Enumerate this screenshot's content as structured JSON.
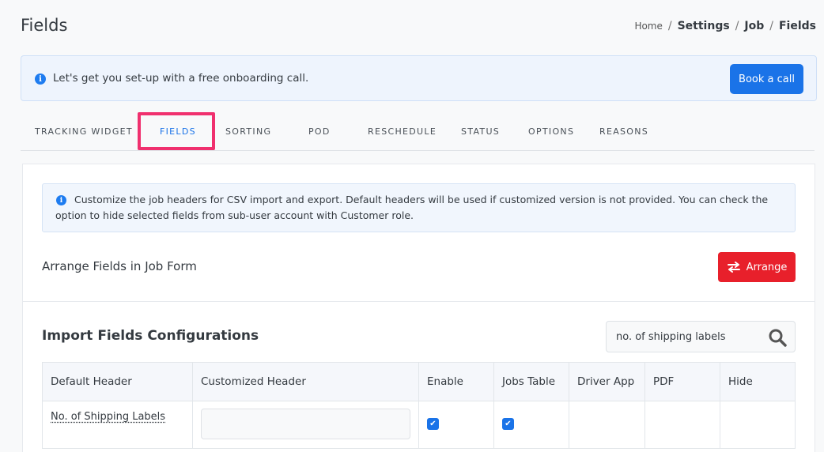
{
  "page": {
    "title": "Fields"
  },
  "breadcrumb": {
    "home": "Home",
    "sep": "/",
    "items": [
      "Settings",
      "Job",
      "Fields"
    ]
  },
  "onboarding": {
    "text": "Let's get you set-up with a free onboarding call.",
    "button": "Book a call"
  },
  "tabs": [
    {
      "label": "TRACKING WIDGET"
    },
    {
      "label": "FIELDS",
      "active": true
    },
    {
      "label": "SORTING"
    },
    {
      "label": "POD"
    },
    {
      "label": "RESCHEDULE"
    },
    {
      "label": "STATUS"
    },
    {
      "label": "OPTIONS"
    },
    {
      "label": "REASONS"
    }
  ],
  "alert": {
    "text": "Customize the job headers for CSV import and export. Default headers will be used if customized version is not provided. You can check the option to hide selected fields from sub-user account with Customer role."
  },
  "arrange": {
    "label": "Arrange Fields in Job Form",
    "button": "Arrange"
  },
  "import": {
    "title": "Import Fields Configurations",
    "search_value": "no. of shipping labels"
  },
  "table": {
    "headers": [
      "Default Header",
      "Customized Header",
      "Enable",
      "Jobs Table",
      "Driver App",
      "PDF",
      "Hide"
    ],
    "rows": [
      {
        "default_header": "No. of Shipping Labels",
        "customized_header": "",
        "enable": true,
        "jobs_table": true,
        "driver_app": false,
        "pdf": false,
        "hide": false
      }
    ]
  },
  "colors": {
    "primary": "#1a73e8",
    "danger": "#e8202b",
    "highlight": "#f0306e"
  }
}
